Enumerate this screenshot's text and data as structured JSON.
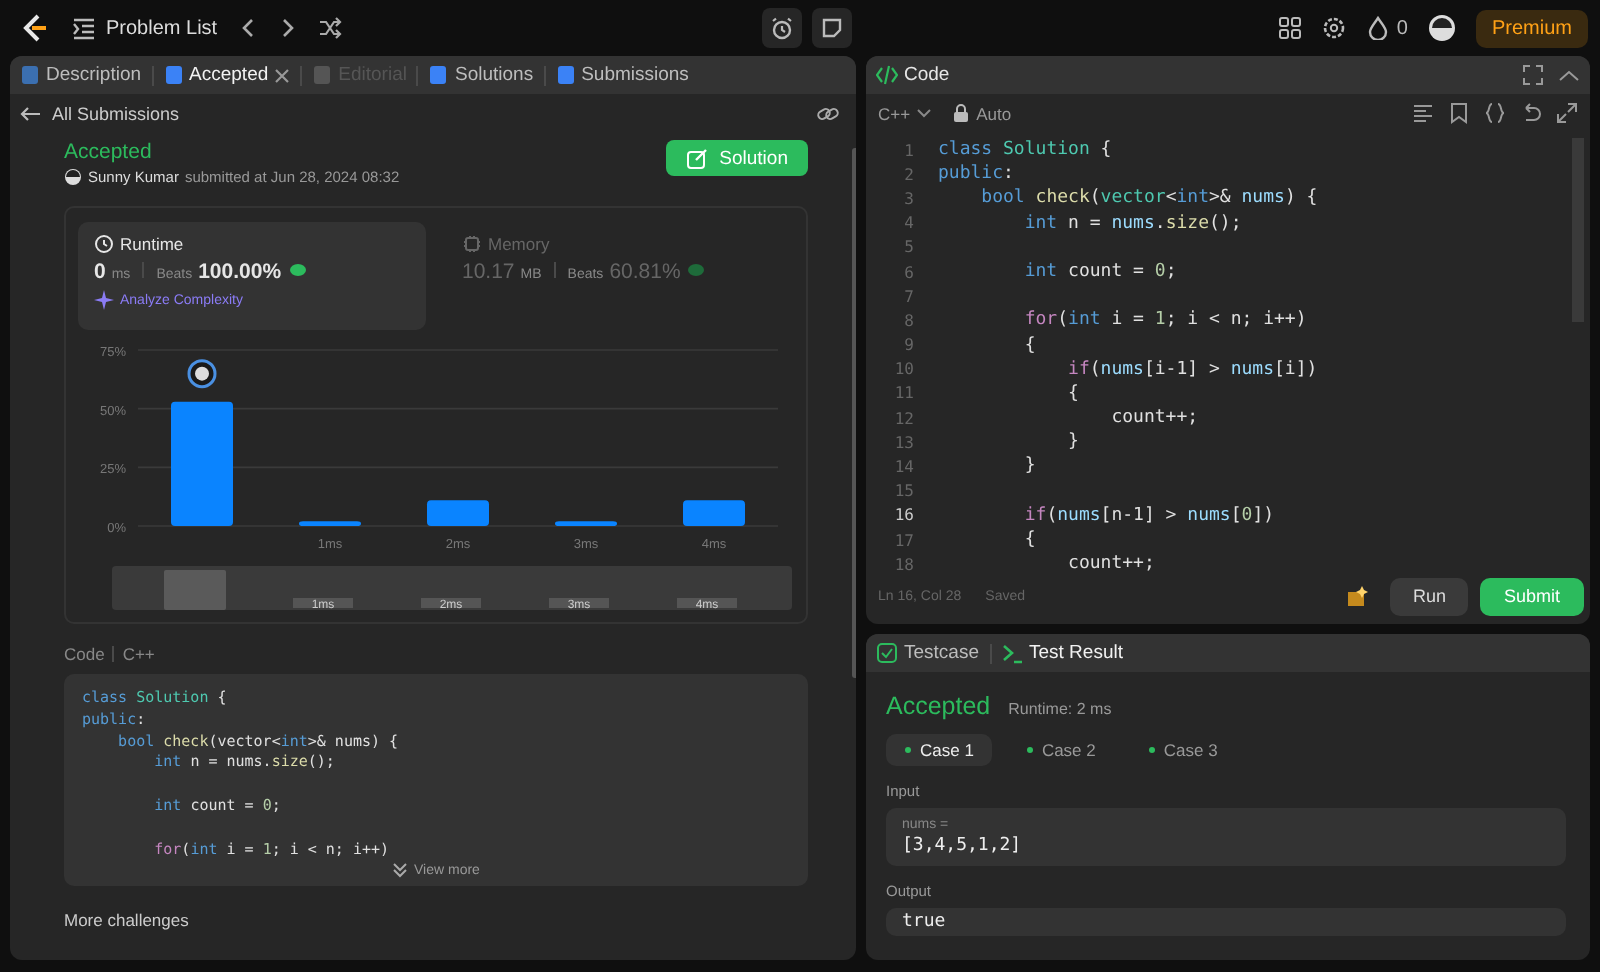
{
  "top_bar": {
    "problem_list": "Problem List",
    "streak_count": "0",
    "premium": "Premium"
  },
  "left_panel": {
    "tabs": [
      {
        "label": "Description",
        "selected": false,
        "disabled": false,
        "closable": false
      },
      {
        "label": "Accepted",
        "selected": true,
        "disabled": false,
        "closable": true
      },
      {
        "label": "Editorial",
        "selected": false,
        "disabled": true,
        "closable": false
      },
      {
        "label": "Solutions",
        "selected": false,
        "disabled": false,
        "closable": false
      },
      {
        "label": "Submissions",
        "selected": false,
        "disabled": false,
        "closable": false
      }
    ],
    "back_link": "All Submissions",
    "submission": {
      "status": "Accepted",
      "author": "Sunny Kumar",
      "submitted_text": "submitted at Jun 28, 2024 08:32",
      "solution_button": "Solution"
    },
    "stats": [
      {
        "kind": "runtime",
        "title": "Runtime",
        "value": "0",
        "unit": "ms",
        "beats_label": "Beats",
        "beats": "100.00%",
        "selected": true,
        "action": "Analyze Complexity"
      },
      {
        "kind": "memory",
        "title": "Memory",
        "value": "10.17",
        "unit": "MB",
        "beats_label": "Beats",
        "beats": "60.81%",
        "selected": false
      }
    ],
    "chart_data": {
      "type": "bar",
      "categories": [
        null,
        "1ms",
        "2ms",
        "3ms",
        "4ms"
      ],
      "values": [
        53,
        2,
        11,
        2,
        11
      ],
      "ylim": [
        0,
        75
      ],
      "yticks": [
        {
          "value": 0,
          "label": "0%"
        },
        {
          "value": 25,
          "label": "25%"
        },
        {
          "value": 50,
          "label": "50%"
        },
        {
          "value": 75,
          "label": "75%"
        }
      ]
    },
    "range_labels": [
      "1ms",
      "2ms",
      "3ms",
      "4ms"
    ],
    "code_label": "Code",
    "code_language": "C++",
    "code_lines": [
      {
        "spaced": false,
        "tokens": [
          {
            "kind": "keyword",
            "text": "class "
          },
          {
            "kind": "type",
            "text": "Solution"
          },
          {
            "kind": "plain",
            "text": " {"
          }
        ]
      },
      {
        "spaced": false,
        "tokens": [
          {
            "kind": "keyword",
            "text": "public"
          },
          {
            "kind": "plain",
            "text": ":"
          }
        ]
      },
      {
        "spaced": false,
        "tokens": [
          {
            "kind": "keyword",
            "text": "    bool "
          },
          {
            "kind": "function",
            "text": "check"
          },
          {
            "kind": "plain",
            "text": "(vector<"
          },
          {
            "kind": "keyword",
            "text": "int"
          },
          {
            "kind": "plain",
            "text": ">& nums) {"
          }
        ]
      },
      {
        "spaced": false,
        "tokens": [
          {
            "kind": "keyword",
            "text": "        int "
          },
          {
            "kind": "plain",
            "text": "n = nums."
          },
          {
            "kind": "function",
            "text": "size"
          },
          {
            "kind": "plain",
            "text": "();"
          }
        ]
      },
      {
        "spaced": true,
        "tokens": [
          {
            "kind": "keyword",
            "text": "        int "
          },
          {
            "kind": "plain",
            "text": "count = "
          },
          {
            "kind": "number",
            "text": "0"
          },
          {
            "kind": "plain",
            "text": ";"
          }
        ]
      },
      {
        "spaced": true,
        "tokens": [
          {
            "kind": "control",
            "text": "        for"
          },
          {
            "kind": "plain",
            "text": "("
          },
          {
            "kind": "keyword",
            "text": "int "
          },
          {
            "kind": "plain",
            "text": "i = "
          },
          {
            "kind": "number",
            "text": "1"
          },
          {
            "kind": "plain",
            "text": "; i < n; i++)"
          }
        ]
      }
    ],
    "view_more": "View more",
    "more_challenges": "More challenges"
  },
  "editor": {
    "title": "Code",
    "language": "C++",
    "mode": "Auto",
    "lines": [
      {
        "number": "1",
        "current": false,
        "tokens": [
          {
            "kind": "keyword",
            "text": "class "
          },
          {
            "kind": "type",
            "text": "Solution"
          },
          {
            "kind": "plain",
            "text": " {"
          }
        ]
      },
      {
        "number": "2",
        "current": false,
        "tokens": [
          {
            "kind": "keyword",
            "text": "public"
          },
          {
            "kind": "plain",
            "text": ":"
          }
        ]
      },
      {
        "number": "3",
        "current": false,
        "tokens": [
          {
            "kind": "keyword",
            "text": "    bool "
          },
          {
            "kind": "function",
            "text": "check"
          },
          {
            "kind": "plain",
            "text": "("
          },
          {
            "kind": "type",
            "text": "vector"
          },
          {
            "kind": "plain",
            "text": "<"
          },
          {
            "kind": "keyword",
            "text": "int"
          },
          {
            "kind": "plain",
            "text": ">& "
          },
          {
            "kind": "variable",
            "text": "nums"
          },
          {
            "kind": "plain",
            "text": ") {"
          }
        ]
      },
      {
        "number": "4",
        "current": false,
        "tokens": [
          {
            "kind": "keyword",
            "text": "        int "
          },
          {
            "kind": "plain",
            "text": "n = "
          },
          {
            "kind": "variable",
            "text": "nums"
          },
          {
            "kind": "plain",
            "text": "."
          },
          {
            "kind": "function",
            "text": "size"
          },
          {
            "kind": "plain",
            "text": "();"
          }
        ]
      },
      {
        "number": "5",
        "current": false
      },
      {
        "number": "6",
        "current": false,
        "tokens": [
          {
            "kind": "keyword",
            "text": "        int "
          },
          {
            "kind": "plain",
            "text": "count = "
          },
          {
            "kind": "number",
            "text": "0"
          },
          {
            "kind": "plain",
            "text": ";"
          }
        ]
      },
      {
        "number": "7",
        "current": false
      },
      {
        "number": "8",
        "current": false,
        "tokens": [
          {
            "kind": "control",
            "text": "        for"
          },
          {
            "kind": "plain",
            "text": "("
          },
          {
            "kind": "keyword",
            "text": "int "
          },
          {
            "kind": "plain",
            "text": "i = "
          },
          {
            "kind": "number",
            "text": "1"
          },
          {
            "kind": "plain",
            "text": "; i < n; i++)"
          }
        ]
      },
      {
        "number": "9",
        "current": false,
        "tokens": [
          {
            "kind": "plain",
            "text": "        {"
          }
        ]
      },
      {
        "number": "10",
        "current": false,
        "tokens": [
          {
            "kind": "control",
            "text": "            if"
          },
          {
            "kind": "plain",
            "text": "("
          },
          {
            "kind": "variable",
            "text": "nums"
          },
          {
            "kind": "plain",
            "text": "[i-1] > "
          },
          {
            "kind": "variable",
            "text": "nums"
          },
          {
            "kind": "plain",
            "text": "[i])"
          }
        ]
      },
      {
        "number": "11",
        "current": false,
        "tokens": [
          {
            "kind": "plain",
            "text": "            {"
          }
        ]
      },
      {
        "number": "12",
        "current": false,
        "tokens": [
          {
            "kind": "plain",
            "text": "                count++;"
          }
        ]
      },
      {
        "number": "13",
        "current": false,
        "tokens": [
          {
            "kind": "plain",
            "text": "            }"
          }
        ]
      },
      {
        "number": "14",
        "current": false,
        "tokens": [
          {
            "kind": "plain",
            "text": "        }"
          }
        ]
      },
      {
        "number": "15",
        "current": false
      },
      {
        "number": "16",
        "current": true,
        "tokens": [
          {
            "kind": "control",
            "text": "        if"
          },
          {
            "kind": "plain",
            "text": "("
          },
          {
            "kind": "variable",
            "text": "nums"
          },
          {
            "kind": "plain",
            "text": "[n-1] > "
          },
          {
            "kind": "variable",
            "text": "nums"
          },
          {
            "kind": "plain",
            "text": "["
          },
          {
            "kind": "number",
            "text": "0"
          },
          {
            "kind": "plain",
            "text": "])"
          }
        ]
      },
      {
        "number": "17",
        "current": false,
        "tokens": [
          {
            "kind": "plain",
            "text": "        {"
          }
        ]
      },
      {
        "number": "18",
        "current": false,
        "tokens": [
          {
            "kind": "plain",
            "text": "            count++;"
          }
        ]
      }
    ],
    "position": "Ln 16, Col 28",
    "save_state": "Saved",
    "run": "Run",
    "submit": "Submit"
  },
  "result_panel": {
    "tabs": [
      {
        "label": "Testcase",
        "selected": false
      },
      {
        "label": "Test Result",
        "selected": true
      }
    ],
    "status": "Accepted",
    "runtime": "Runtime: 2 ms",
    "cases": [
      {
        "label": "Case 1",
        "selected": true
      },
      {
        "label": "Case 2",
        "selected": false
      },
      {
        "label": "Case 3",
        "selected": false
      }
    ],
    "input_label": "Input",
    "inputs": [
      {
        "name": "nums =",
        "value": "[3,4,5,1,2]"
      }
    ],
    "output_label": "Output",
    "output": "true"
  }
}
